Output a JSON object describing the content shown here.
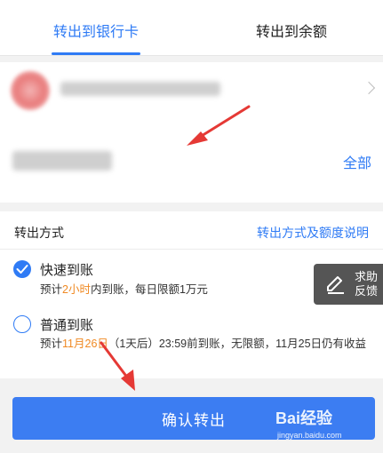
{
  "tabs": {
    "active_label": "转出到银行卡",
    "inactive_label": "转出到余额"
  },
  "card": {
    "all_label": "全部"
  },
  "method": {
    "heading": "转出方式",
    "link": "转出方式及额度说明",
    "options": [
      {
        "title": "快速到账",
        "desc_prefix": "预计",
        "desc_highlight": "2小时",
        "desc_suffix": "内到账，每日限额1万元",
        "checked": true
      },
      {
        "title": "普通到账",
        "desc_prefix": "预计",
        "desc_highlight": "11月26日",
        "desc_suffix": "（1天后）23:59前到账，无限额，11月25日仍有收益",
        "checked": false
      }
    ]
  },
  "help": {
    "label": "求助反馈"
  },
  "confirm": {
    "label": "确认转出"
  },
  "watermark": {
    "main": "Bai经验",
    "sub": "jingyan.baidu.com"
  },
  "colors": {
    "accent": "#2f7bf5",
    "highlight": "#f08a24",
    "annotation": "#e53935"
  }
}
